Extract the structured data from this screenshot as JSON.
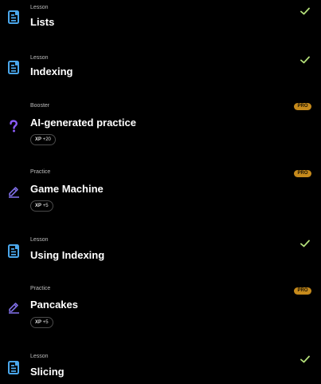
{
  "colors": {
    "background": "#000000",
    "lesson_icon": "#4aa6ea",
    "booster_icon": "#8a5cf6",
    "practice_icon": "#7c6ce0",
    "check": "#b4e07a",
    "pro_badge": "#c68a1c"
  },
  "items": [
    {
      "kind": "Lesson",
      "title": "Lists",
      "icon": "document-icon",
      "completed": true
    },
    {
      "kind": "Lesson",
      "title": "Indexing",
      "icon": "document-icon",
      "completed": true
    },
    {
      "kind": "Booster",
      "title": "AI-generated practice",
      "icon": "question-mark-icon",
      "pro": "PRO",
      "xp_label": "XP",
      "xp_value": "+20"
    },
    {
      "kind": "Practice",
      "title": "Game Machine",
      "icon": "pencil-icon",
      "pro": "PRO",
      "xp_label": "XP",
      "xp_value": "+5"
    },
    {
      "kind": "Lesson",
      "title": "Using Indexing",
      "icon": "document-icon",
      "completed": true
    },
    {
      "kind": "Practice",
      "title": "Pancakes",
      "icon": "pencil-icon",
      "pro": "PRO",
      "xp_label": "XP",
      "xp_value": "+5"
    },
    {
      "kind": "Lesson",
      "title": "Slicing",
      "icon": "document-icon",
      "completed": true
    }
  ]
}
